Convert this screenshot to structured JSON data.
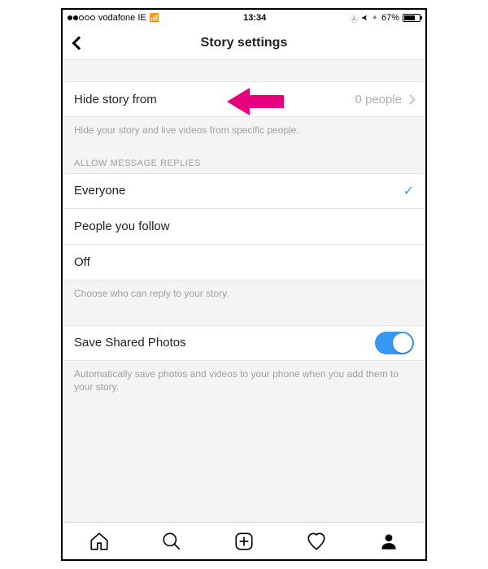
{
  "statusbar": {
    "carrier": "vodafone IE",
    "time": "13:34",
    "battery_pct": "67%"
  },
  "nav": {
    "title": "Story settings"
  },
  "hide": {
    "label": "Hide story from",
    "value": "0 people",
    "helper": "Hide your story and live videos from specific people."
  },
  "replies": {
    "header": "ALLOW MESSAGE REPLIES",
    "options": [
      "Everyone",
      "People you follow",
      "Off"
    ],
    "selected_index": 0,
    "helper": "Choose who can reply to your story."
  },
  "save": {
    "label": "Save Shared Photos",
    "enabled": true,
    "helper": "Automatically save photos and videos to your phone when you add them to your story."
  },
  "annotation": {
    "color": "#e6007e"
  }
}
